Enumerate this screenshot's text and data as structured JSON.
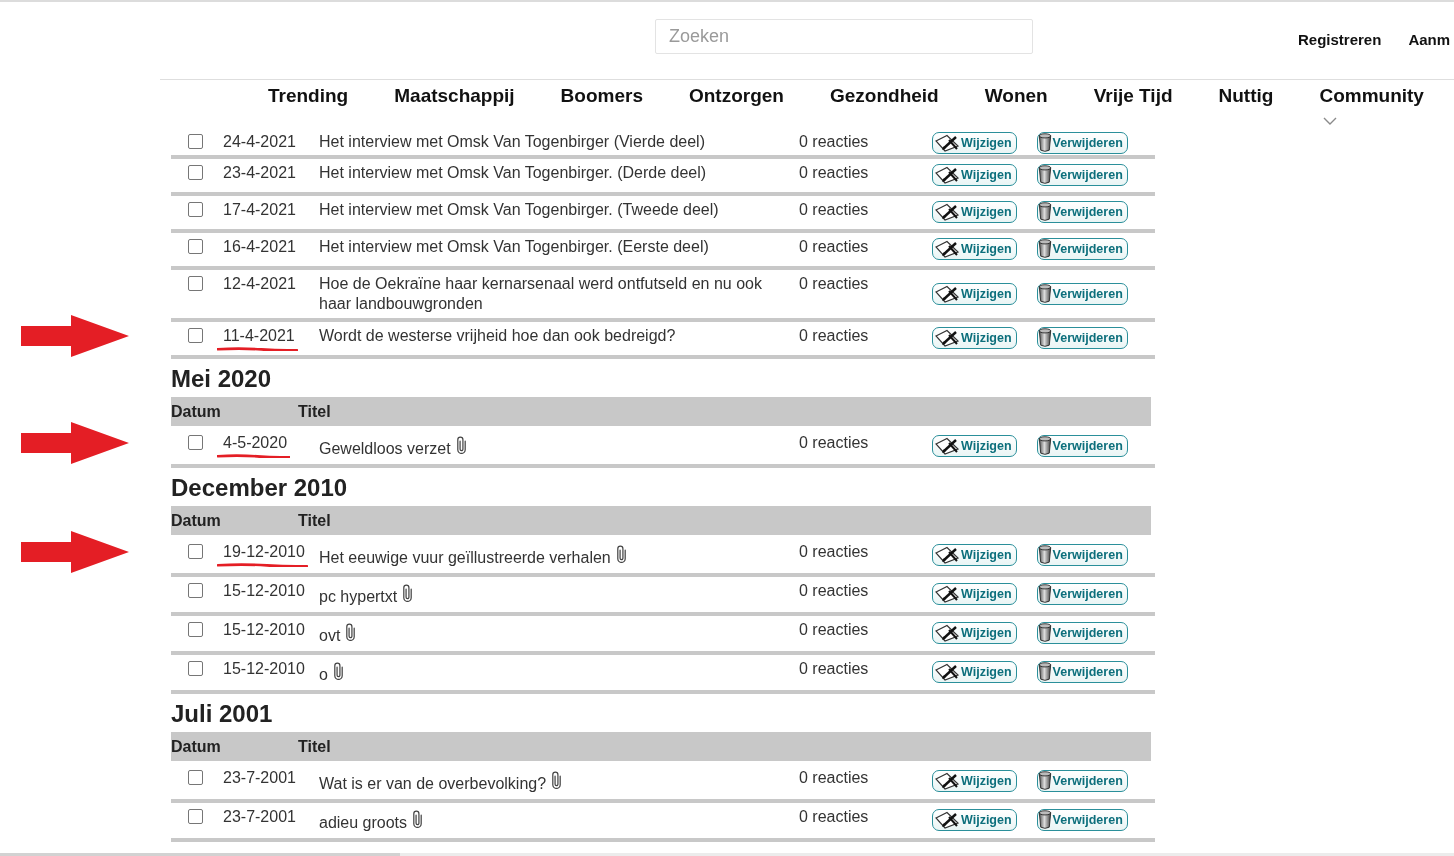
{
  "search": {
    "placeholder": "Zoeken"
  },
  "account_links": [
    "Registreren",
    "Aanm"
  ],
  "nav": [
    {
      "label": "Trending",
      "kind": "link"
    },
    {
      "label": "Maatschappij",
      "kind": "link"
    },
    {
      "label": "Boomers",
      "kind": "link"
    },
    {
      "label": "Ontzorgen",
      "kind": "link"
    },
    {
      "label": "Gezondheid",
      "kind": "link"
    },
    {
      "label": "Wonen",
      "kind": "link"
    },
    {
      "label": "Vrije Tijd",
      "kind": "link"
    },
    {
      "label": "Nuttig",
      "kind": "link"
    },
    {
      "label": "Community",
      "kind": "dropdown"
    }
  ],
  "sections": [
    {
      "rows": [
        {
          "checked": false,
          "date": "24-4-2021",
          "title": "Het interview met Omsk Van Togenbirger (Vierde deel)",
          "attachment": false,
          "reactions": "0 reacties",
          "annotated": false,
          "actions": [
            {
              "kind": "edit",
              "label": "Wijzigen"
            },
            {
              "kind": "delete",
              "label": "Verwijderen"
            }
          ]
        },
        {
          "checked": false,
          "date": "23-4-2021",
          "title": "Het interview met Omsk Van Togenbirger. (Derde deel)",
          "attachment": false,
          "reactions": "0 reacties",
          "annotated": false,
          "actions": [
            {
              "kind": "edit",
              "label": "Wijzigen"
            },
            {
              "kind": "delete",
              "label": "Verwijderen"
            }
          ]
        },
        {
          "checked": false,
          "date": "17-4-2021",
          "title": "Het interview met Omsk Van Togenbirger. (Tweede deel)",
          "attachment": false,
          "reactions": "0 reacties",
          "annotated": false,
          "actions": [
            {
              "kind": "edit",
              "label": "Wijzigen"
            },
            {
              "kind": "delete",
              "label": "Verwijderen"
            }
          ]
        },
        {
          "checked": false,
          "date": "16-4-2021",
          "title": "Het interview met Omsk Van Togenbirger. (Eerste deel)",
          "attachment": false,
          "reactions": "0 reacties",
          "annotated": false,
          "actions": [
            {
              "kind": "edit",
              "label": "Wijzigen"
            },
            {
              "kind": "delete",
              "label": "Verwijderen"
            }
          ]
        },
        {
          "checked": false,
          "date": "12-4-2021",
          "title": "Hoe de Oekraïne haar kernarsenaal werd ontfutseld en nu ook haar landbouwgronden",
          "attachment": false,
          "reactions": "0 reacties",
          "annotated": false,
          "actions": [
            {
              "kind": "edit",
              "label": "Wijzigen"
            },
            {
              "kind": "delete",
              "label": "Verwijderen"
            }
          ]
        },
        {
          "checked": false,
          "date": "11-4-2021",
          "title": "Wordt de westerse vrijheid hoe dan ook bedreigd?",
          "attachment": false,
          "reactions": "0 reacties",
          "annotated": true,
          "actions": [
            {
              "kind": "edit",
              "label": "Wijzigen"
            },
            {
              "kind": "delete",
              "label": "Verwijderen"
            }
          ]
        }
      ]
    },
    {
      "heading": "Mei 2020",
      "columns": [
        "Datum",
        "Titel"
      ],
      "rows": [
        {
          "checked": false,
          "date": "4-5-2020",
          "title": "Geweldloos verzet",
          "attachment": true,
          "reactions": "0 reacties",
          "annotated": true,
          "actions": [
            {
              "kind": "edit",
              "label": "Wijzigen"
            },
            {
              "kind": "delete",
              "label": "Verwijderen"
            }
          ]
        }
      ]
    },
    {
      "heading": "December 2010",
      "columns": [
        "Datum",
        "Titel"
      ],
      "rows": [
        {
          "checked": false,
          "date": "19-12-2010",
          "title": "Het eeuwige vuur geïllustreerde verhalen",
          "attachment": true,
          "reactions": "0 reacties",
          "annotated": true,
          "actions": [
            {
              "kind": "edit",
              "label": "Wijzigen"
            },
            {
              "kind": "delete",
              "label": "Verwijderen"
            }
          ]
        },
        {
          "checked": false,
          "date": "15-12-2010",
          "title": "pc hypertxt",
          "attachment": true,
          "reactions": "0 reacties",
          "annotated": false,
          "actions": [
            {
              "kind": "edit",
              "label": "Wijzigen"
            },
            {
              "kind": "delete",
              "label": "Verwijderen"
            }
          ]
        },
        {
          "checked": false,
          "date": "15-12-2010",
          "title": "ovt",
          "attachment": true,
          "reactions": "0 reacties",
          "annotated": false,
          "actions": [
            {
              "kind": "edit",
              "label": "Wijzigen"
            },
            {
              "kind": "delete",
              "label": "Verwijderen"
            }
          ]
        },
        {
          "checked": false,
          "date": "15-12-2010",
          "title": "o",
          "attachment": true,
          "reactions": "0 reacties",
          "annotated": false,
          "actions": [
            {
              "kind": "edit",
              "label": "Wijzigen"
            },
            {
              "kind": "delete",
              "label": "Verwijderen"
            }
          ]
        }
      ]
    },
    {
      "heading": "Juli 2001",
      "columns": [
        "Datum",
        "Titel"
      ],
      "rows": [
        {
          "checked": false,
          "date": "23-7-2001",
          "title": "Wat is er van de overbevolking?",
          "attachment": true,
          "reactions": "0 reacties",
          "annotated": false,
          "actions": [
            {
              "kind": "edit",
              "label": "Wijzigen"
            },
            {
              "kind": "delete",
              "label": "Verwijderen"
            }
          ]
        },
        {
          "checked": false,
          "date": "23-7-2001",
          "title": "adieu groots",
          "attachment": true,
          "reactions": "0 reacties",
          "annotated": false,
          "actions": [
            {
              "kind": "edit",
              "label": "Wijzigen"
            },
            {
              "kind": "delete",
              "label": "Verwijderen"
            }
          ]
        }
      ]
    }
  ]
}
